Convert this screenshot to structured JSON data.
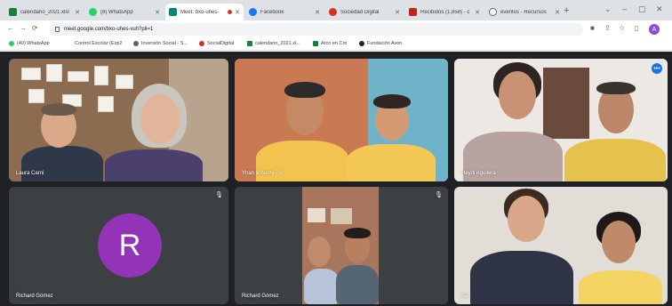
{
  "browser": {
    "tabs": [
      {
        "label": "calendario_2021.xlsl",
        "color": "#188038"
      },
      {
        "label": "(8) WhatsApp",
        "color": "#25d366"
      },
      {
        "label": "Meet: bxo-uhes-",
        "color": "#00897b",
        "active": true
      },
      {
        "label": "Facebook",
        "color": "#1877f2"
      },
      {
        "label": "Sociedad Digital",
        "color": "#d93025"
      },
      {
        "label": "Recibidos (1,858) - c",
        "color": "#c5221f"
      },
      {
        "label": "eventos - Recursos",
        "color": "#5f6368"
      }
    ],
    "new_tab": "+",
    "url": "meet.google.com/bxo-uhes-vuh?pli=1",
    "window_controls": {
      "minimize": "–",
      "maximize": "▢",
      "close": "✕"
    },
    "profile_initial": "A",
    "bookmarks": [
      {
        "label": "(40) WhatsApp",
        "color": "#25d366"
      },
      {
        "label": "Control Escolar (Exp2",
        "color": ""
      },
      {
        "label": "Inversión Social - S...",
        "color": "#5f6368"
      },
      {
        "label": "SocialDigital",
        "color": "#d93025"
      },
      {
        "label": "calendario_2021.xl...",
        "color": "#188038"
      },
      {
        "label": "Arco en Cro",
        "color": "#188038"
      },
      {
        "label": "Fundación Avon",
        "color": "#202124"
      }
    ]
  },
  "meet": {
    "tiles": [
      {
        "name": "Laura Carni"
      },
      {
        "name": "Yhan & Aucry - S"
      },
      {
        "name": "Heydi Aguilera"
      },
      {
        "name": "Richard Gómez",
        "avatar_letter": "R",
        "avatar_color": "#9334b8"
      },
      {
        "name": "Richard Gómez"
      },
      {
        "name": "Sa"
      }
    ]
  }
}
